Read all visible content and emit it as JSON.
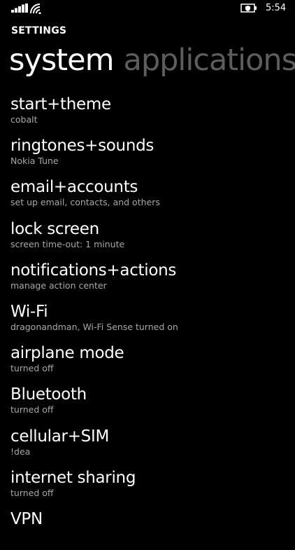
{
  "status_bar": {
    "time": "5:54",
    "icons": [
      "signal-icon",
      "wifi-icon",
      "battery-saver-icon"
    ]
  },
  "app": {
    "title": "SETTINGS"
  },
  "pivot": {
    "tabs": [
      {
        "label": "system",
        "active": true
      },
      {
        "label": "applications",
        "active": false
      }
    ]
  },
  "items": [
    {
      "title": "start+theme",
      "sub": "cobalt"
    },
    {
      "title": "ringtones+sounds",
      "sub": "Nokia Tune"
    },
    {
      "title": "email+accounts",
      "sub": "set up email, contacts, and others"
    },
    {
      "title": "lock screen",
      "sub": "screen time-out: 1 minute"
    },
    {
      "title": "notifications+actions",
      "sub": "manage action center"
    },
    {
      "title": "Wi-Fi",
      "sub": "dragonandman, Wi-Fi Sense turned on"
    },
    {
      "title": "airplane mode",
      "sub": "turned off"
    },
    {
      "title": "Bluetooth",
      "sub": "turned off"
    },
    {
      "title": "cellular+SIM",
      "sub": "!dea"
    },
    {
      "title": "internet sharing",
      "sub": "turned off"
    },
    {
      "title": "VPN",
      "sub": ""
    }
  ],
  "colors": {
    "background": "#000000",
    "text": "#ffffff",
    "subtext": "#a8a8a8",
    "inactive_tab": "#5d5d5d"
  }
}
